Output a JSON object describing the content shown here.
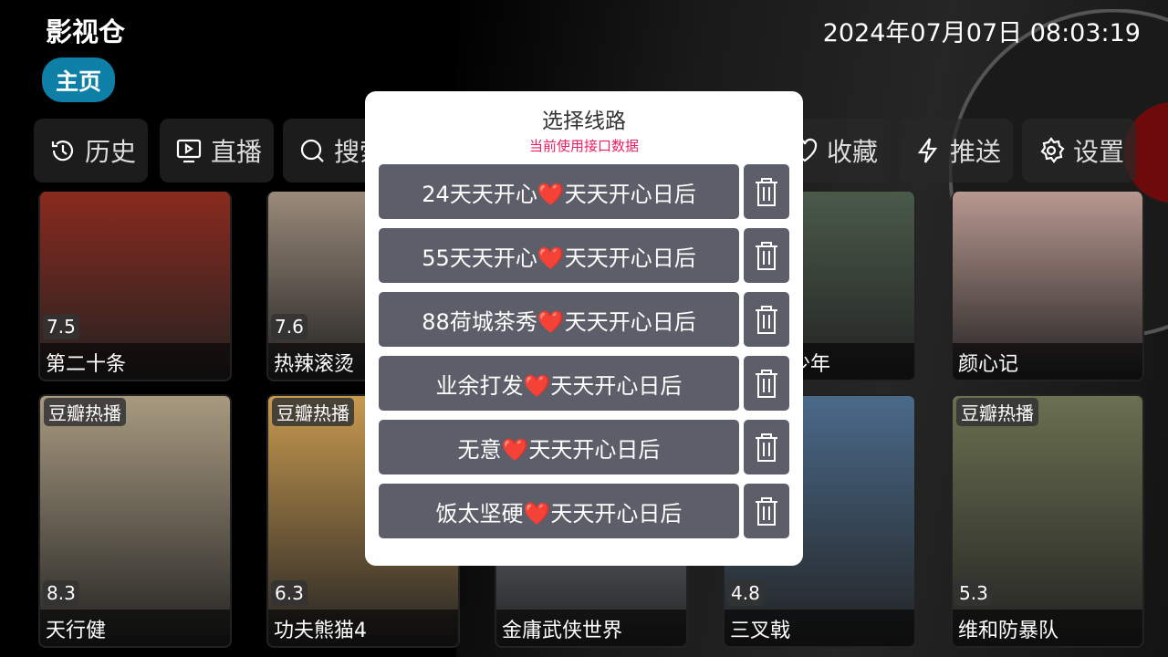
{
  "header": {
    "app_title": "影视仓",
    "datetime": "2024年07月07日 08:03:19",
    "home_tab": "主页"
  },
  "nav": [
    {
      "label": "历史",
      "icon": "history-icon"
    },
    {
      "label": "直播",
      "icon": "tv-play-icon"
    },
    {
      "label": "搜索",
      "icon": "search-icon"
    },
    {
      "label": "收藏",
      "icon": "heart-icon"
    },
    {
      "label": "推送",
      "icon": "bolt-icon"
    },
    {
      "label": "设置",
      "icon": "gear-icon"
    }
  ],
  "posters": [
    {
      "title": "第二十条",
      "score": "7.5",
      "badge": "",
      "color": "#8a2a1e"
    },
    {
      "title": "热辣滚烫",
      "score": "7.6",
      "badge": "",
      "color": "#9a8a7a"
    },
    {
      "title": "",
      "score": "",
      "badge": "",
      "color": "#444"
    },
    {
      "title": "影子的少年",
      "score": "",
      "badge": "",
      "color": "#4a5a4a"
    },
    {
      "title": "颜心记",
      "score": "",
      "badge": "",
      "color": "#b89890"
    },
    {
      "title": "天行健",
      "score": "8.3",
      "badge": "豆瓣热播",
      "color": "#a89a80"
    },
    {
      "title": "功夫熊猫4",
      "score": "6.3",
      "badge": "豆瓣热播",
      "color": "#c89a50"
    },
    {
      "title": "金庸武侠世界",
      "score": "",
      "badge": "",
      "color": "#8a9098"
    },
    {
      "title": "三叉戟",
      "score": "4.8",
      "badge": "",
      "color": "#4a6a8a"
    },
    {
      "title": "维和防暴队",
      "score": "5.3",
      "badge": "豆瓣热播",
      "color": "#6a7050"
    }
  ],
  "dialog": {
    "title": "选择线路",
    "subtitle": "当前使用接口数据",
    "routes": [
      "24天天开心❤️天天开心日后",
      "55天天开心❤️天天开心日后",
      "88荷城茶秀❤️天天开心日后",
      "业余打发❤️天天开心日后",
      "无意❤️天天开心日后",
      "饭太坚硬❤️天天开心日后"
    ]
  }
}
